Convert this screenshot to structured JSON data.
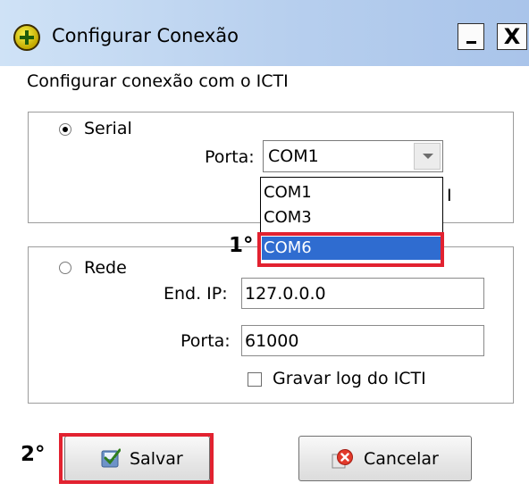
{
  "window": {
    "title": "Configurar Conexão",
    "minimize_icon": "minimize-icon",
    "close_label": "X"
  },
  "subtitle": "Configurar conexão com o ICTI",
  "serial": {
    "radio_label": "Serial",
    "checked": true,
    "port_label": "Porta:",
    "port_value": "COM1",
    "dropdown_options": [
      "COM1",
      "COM3",
      "COM6"
    ],
    "highlighted_option": "COM6",
    "obscured_fragment": "I"
  },
  "rede": {
    "radio_label": "Rede",
    "checked": false,
    "ip_label": "End. IP:",
    "ip_value": "127.0.0.0",
    "port_label": "Porta:",
    "port_value": "61000",
    "log_checkbox_label": "Gravar log do ICTI",
    "log_checked": false
  },
  "steps": {
    "step1": "1°",
    "step2": "2°"
  },
  "buttons": {
    "save_label": "Salvar",
    "cancel_label": "Cancelar"
  },
  "colors": {
    "annotation_red": "#e22230",
    "selection_blue": "#2f6cd0",
    "titlebar_blue": "#b7cfee"
  }
}
